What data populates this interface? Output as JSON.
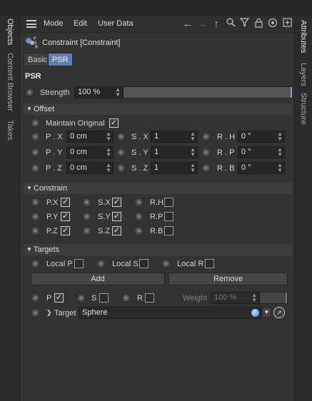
{
  "side_tabs_left": [
    "Objects",
    "Content Browser",
    "Takes"
  ],
  "side_tabs_right": [
    "Attributes",
    "Layers",
    "Structure"
  ],
  "toolbar": {
    "menu": [
      "Mode",
      "Edit",
      "User Data"
    ],
    "icons": [
      "arrow-left-icon",
      "arrow-right-icon",
      "arrow-up-icon",
      "search-icon",
      "filter-icon",
      "lock-icon",
      "target-icon",
      "new-panel-icon"
    ]
  },
  "object": {
    "title": "Constraint [Constraint]",
    "icon": "constraint-psr-icon"
  },
  "mode_tabs": [
    "Basic",
    "PSR"
  ],
  "active_mode_tab": "PSR",
  "psr": {
    "section_title": "PSR",
    "strength_label": "Strength",
    "strength_value": "100 %",
    "strength_fraction": 1.0
  },
  "offset": {
    "title": "Offset",
    "maintain_label": "Maintain Original",
    "maintain_checked": true,
    "rows": [
      {
        "p_label": "P . X",
        "p_value": "0 cm",
        "s_label": "S . X",
        "s_value": "1",
        "r_label": "R . H",
        "r_value": "0 °"
      },
      {
        "p_label": "P . Y",
        "p_value": "0 cm",
        "s_label": "S . Y",
        "s_value": "1",
        "r_label": "R . P",
        "r_value": "0 °"
      },
      {
        "p_label": "P . Z",
        "p_value": "0 cm",
        "s_label": "S . Z",
        "s_value": "1",
        "r_label": "R . B",
        "r_value": "0 °"
      }
    ]
  },
  "constrain": {
    "title": "Constrain",
    "rows": [
      {
        "p_label": "P.X",
        "p_on": true,
        "s_label": "S.X",
        "s_on": true,
        "r_label": "R.H",
        "r_on": false
      },
      {
        "p_label": "P.Y",
        "p_on": true,
        "s_label": "S.Y",
        "s_on": true,
        "r_label": "R.P",
        "r_on": false
      },
      {
        "p_label": "P.Z",
        "p_on": true,
        "s_label": "S.Z",
        "s_on": true,
        "r_label": "R.B",
        "r_on": false
      }
    ]
  },
  "targets": {
    "title": "Targets",
    "local_p_label": "Local P",
    "local_s_label": "Local S",
    "local_r_label": "Local R",
    "add_label": "Add",
    "remove_label": "Remove",
    "p_label": "P",
    "p_on": true,
    "s_label": "S",
    "s_on": false,
    "r_label": "R",
    "r_on": false,
    "weight_label": "Weight",
    "weight_value": "100 %",
    "target_label": "Target",
    "target_value": "Sphere"
  },
  "colors": {
    "accent": "#5f7fb4",
    "panel": "#333333",
    "field": "#262626"
  }
}
